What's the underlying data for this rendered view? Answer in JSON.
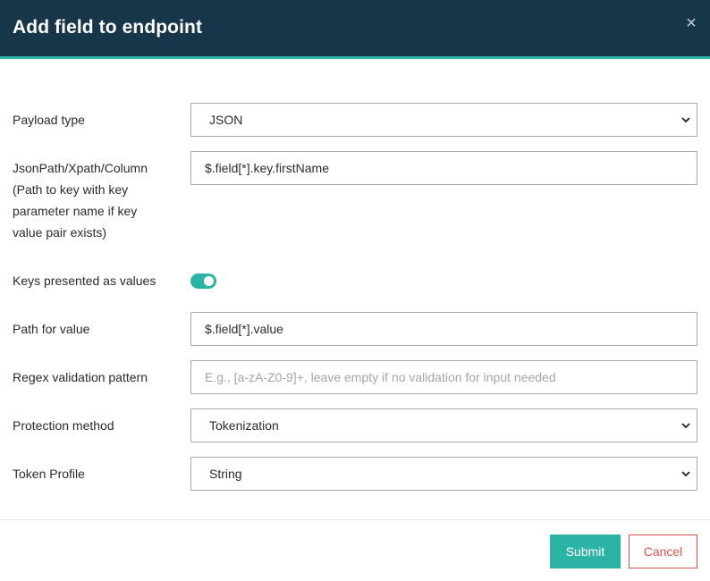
{
  "dialog": {
    "title": "Add field to endpoint",
    "close_label": "×"
  },
  "form": {
    "payload_type": {
      "label": "Payload type",
      "value": "JSON"
    },
    "path": {
      "label_lines": [
        "JsonPath/Xpath/Column",
        "(Path to key with key",
        "parameter name if key",
        "value pair exists)"
      ],
      "value": "$.field[*].key.firstName"
    },
    "keys_as_values": {
      "label": "Keys presented as values",
      "enabled": true
    },
    "path_for_value": {
      "label": "Path for value",
      "value": "$.field[*].value"
    },
    "regex": {
      "label": "Regex validation pattern",
      "value": "",
      "placeholder": "E.g., [a-zA-Z0-9]+, leave empty if no validation for input needed"
    },
    "protection_method": {
      "label": "Protection method",
      "value": "Tokenization"
    },
    "token_profile": {
      "label": "Token Profile",
      "value": "String"
    }
  },
  "footer": {
    "submit_label": "Submit",
    "cancel_label": "Cancel"
  },
  "colors": {
    "header": "#17364a",
    "accent": "#2bb3a5",
    "cancel": "#d9534f"
  }
}
